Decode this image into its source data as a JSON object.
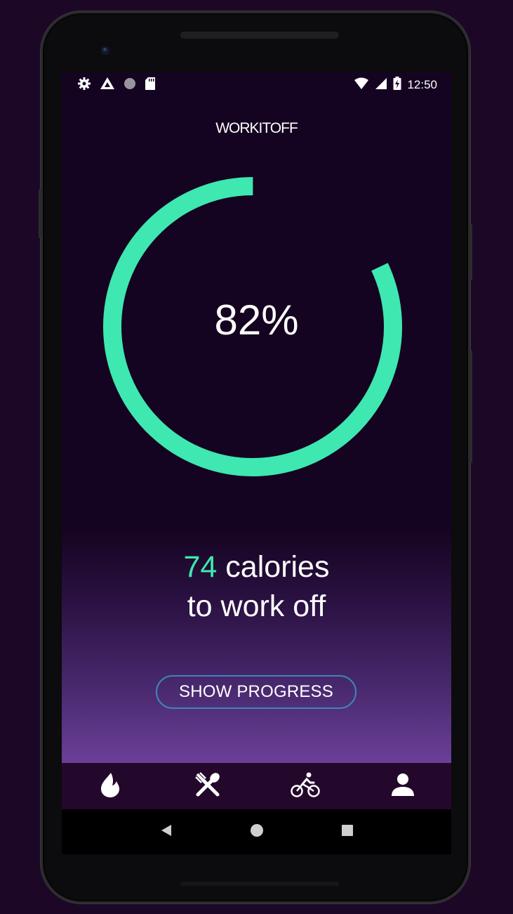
{
  "status_bar": {
    "time": "12:50",
    "left_icons": [
      "settings-icon",
      "drive-icon",
      "circle-dot-icon",
      "sd-card-icon"
    ],
    "right_icons": [
      "wifi-icon",
      "signal-icon",
      "battery-charging-icon"
    ]
  },
  "app": {
    "logo_text": "WORKITOFF"
  },
  "progress": {
    "percent_label": "82%",
    "fraction": 0.82,
    "ring_color": "#3ee8b0"
  },
  "calories": {
    "number": "74",
    "unit_text": " calories",
    "line2": "to work off",
    "accent_color": "#3ee8b0"
  },
  "actions": {
    "show_progress_label": "SHOW PROGRESS"
  },
  "bottom_nav": {
    "items": [
      {
        "icon": "flame-icon"
      },
      {
        "icon": "utensils-icon"
      },
      {
        "icon": "cyclist-icon"
      },
      {
        "icon": "profile-icon"
      }
    ]
  },
  "system_nav": {
    "icons": [
      "back-icon",
      "home-icon",
      "recents-icon"
    ]
  }
}
